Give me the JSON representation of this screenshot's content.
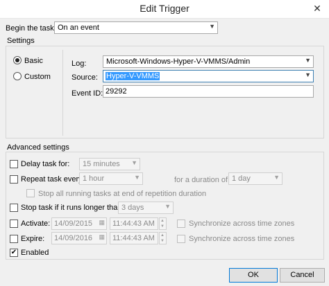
{
  "window": {
    "title": "Edit Trigger"
  },
  "begin_task": {
    "label": "Begin the task:",
    "value": "On an event"
  },
  "settings": {
    "label": "Settings",
    "basic_label": "Basic",
    "custom_label": "Custom",
    "selected": "Basic",
    "log_label": "Log:",
    "log_value": "Microsoft-Windows-Hyper-V-VMMS/Admin",
    "source_label": "Source:",
    "source_value": "Hyper-V-VMMS",
    "eventid_label": "Event ID:",
    "eventid_value": "29292"
  },
  "advanced": {
    "label": "Advanced settings",
    "delay": {
      "label": "Delay task for:",
      "checked": false,
      "value": "15 minutes"
    },
    "repeat": {
      "label": "Repeat task every:",
      "checked": false,
      "value": "1 hour",
      "duration_label": "for a duration of:",
      "duration_value": "1 day"
    },
    "stop_running": {
      "label": "Stop all running tasks at end of repetition duration",
      "checked": false
    },
    "stop_longer": {
      "label": "Stop task if it runs longer than:",
      "checked": false,
      "value": "3 days"
    },
    "activate": {
      "label": "Activate:",
      "checked": false,
      "date": "14/09/2015",
      "time": "11:44:43 AM",
      "sync_label": "Synchronize across time zones",
      "sync_checked": false
    },
    "expire": {
      "label": "Expire:",
      "checked": false,
      "date": "14/09/2016",
      "time": "11:44:43 AM",
      "sync_label": "Synchronize across time zones",
      "sync_checked": false
    },
    "enabled": {
      "label": "Enabled",
      "checked": true
    }
  },
  "buttons": {
    "ok": "OK",
    "cancel": "Cancel"
  },
  "icons": {
    "close": "close-icon",
    "dropdown": "chevron-down-icon",
    "check": "checkmark-icon",
    "calendar": "calendar-icon"
  }
}
